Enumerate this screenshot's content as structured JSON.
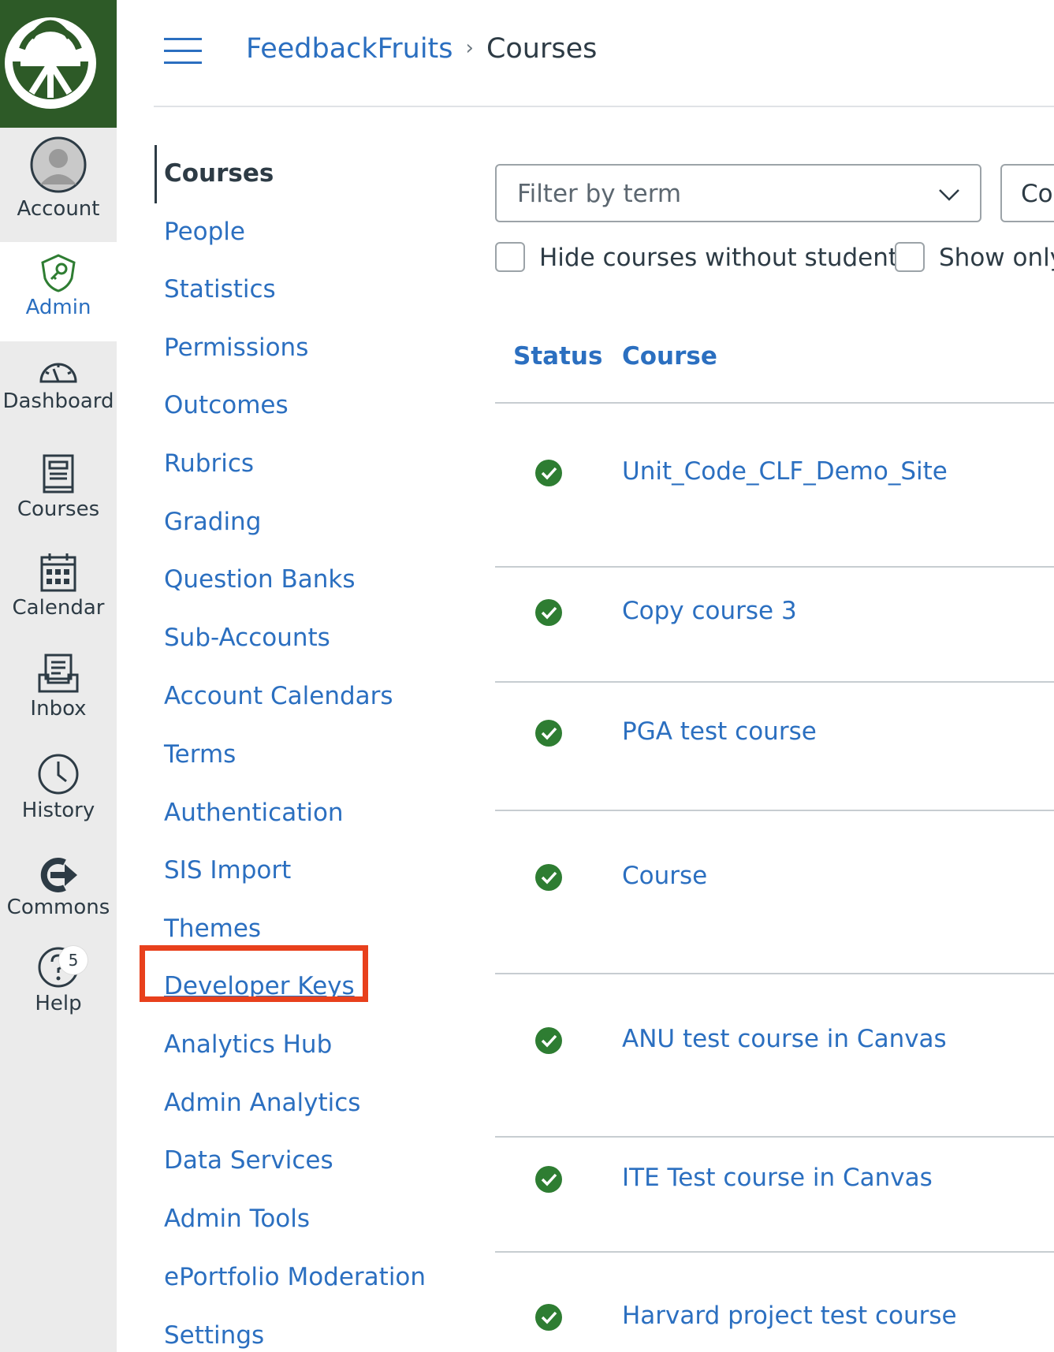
{
  "global_nav": {
    "logo_icon": "feedbackfruits-logo-icon",
    "items": [
      {
        "label": "Account",
        "icon": "avatar-icon"
      },
      {
        "label": "Admin",
        "icon": "shield-icon",
        "active": true
      },
      {
        "label": "Dashboard",
        "icon": "dashboard-icon"
      },
      {
        "label": "Courses",
        "icon": "courses-icon"
      },
      {
        "label": "Calendar",
        "icon": "calendar-icon"
      },
      {
        "label": "Inbox",
        "icon": "inbox-icon"
      },
      {
        "label": "History",
        "icon": "history-icon"
      },
      {
        "label": "Commons",
        "icon": "commons-icon"
      },
      {
        "label": "Help",
        "icon": "help-icon",
        "badge": "5"
      }
    ]
  },
  "header": {
    "breadcrumb_account": "FeedbackFruits",
    "breadcrumb_sep": "›",
    "breadcrumb_current": "Courses"
  },
  "section_nav": {
    "items": [
      "Courses",
      "People",
      "Statistics",
      "Permissions",
      "Outcomes",
      "Rubrics",
      "Grading",
      "Question Banks",
      "Sub-Accounts",
      "Account Calendars",
      "Terms",
      "Authentication",
      "SIS Import",
      "Themes",
      "Developer Keys",
      "Analytics Hub",
      "Admin Analytics",
      "Data Services",
      "Admin Tools",
      "ePortfolio Moderation",
      "Settings"
    ],
    "active": "Courses",
    "highlighted": "Developer Keys",
    "highlight_color": "#e8401c"
  },
  "filters": {
    "term_placeholder": "Filter by term",
    "search_partial": "Co",
    "hide_without_students": "Hide courses without students",
    "show_only": "Show only"
  },
  "table": {
    "col_status": "Status",
    "col_course": "Course",
    "rows": [
      {
        "name": "Unit_Code_CLF_Demo_Site",
        "status": "published"
      },
      {
        "name": "Copy course 3",
        "status": "published"
      },
      {
        "name": "PGA test course",
        "status": "published"
      },
      {
        "name": "Course",
        "status": "published"
      },
      {
        "name": "ANU test course in Canvas",
        "status": "published"
      },
      {
        "name": "ITE Test course in Canvas",
        "status": "published"
      },
      {
        "name": "Harvard project test course",
        "status": "published"
      }
    ]
  },
  "colors": {
    "brand": "#2d5a27",
    "link": "#2b6fc0",
    "status_ok": "#2e7d32"
  }
}
